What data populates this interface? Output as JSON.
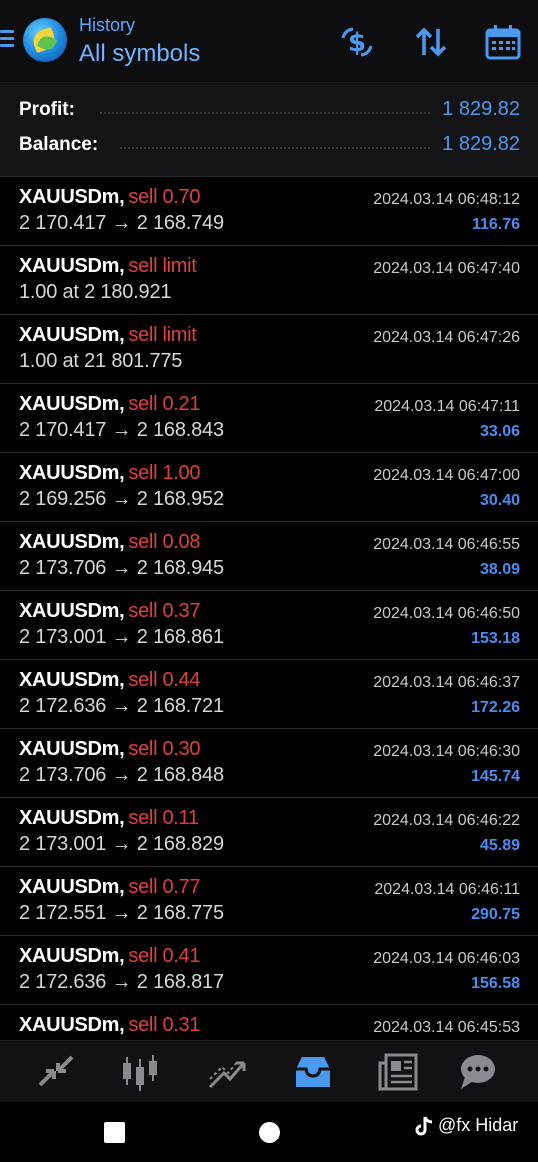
{
  "header": {
    "subtitle": "History",
    "title": "All symbols",
    "accent": "#4a9bf0"
  },
  "summary": {
    "profit_label": "Profit:",
    "profit_value": "1 829.82",
    "balance_label": "Balance:",
    "balance_value": "1 829.82"
  },
  "trades": [
    {
      "symbol": "XAUUSDm,",
      "side": "sell 0.70",
      "prices": "2 170.417 → 2 168.749",
      "time": "2024.03.14 06:48:12",
      "profit": "116.76"
    },
    {
      "symbol": "XAUUSDm,",
      "side": "sell limit",
      "prices": "1.00 at 2 180.921",
      "time": "2024.03.14 06:47:40",
      "profit": ""
    },
    {
      "symbol": "XAUUSDm,",
      "side": "sell limit",
      "prices": "1.00 at 21 801.775",
      "time": "2024.03.14 06:47:26",
      "profit": ""
    },
    {
      "symbol": "XAUUSDm,",
      "side": "sell 0.21",
      "prices": "2 170.417 → 2 168.843",
      "time": "2024.03.14 06:47:11",
      "profit": "33.06"
    },
    {
      "symbol": "XAUUSDm,",
      "side": "sell 1.00",
      "prices": "2 169.256 → 2 168.952",
      "time": "2024.03.14 06:47:00",
      "profit": "30.40"
    },
    {
      "symbol": "XAUUSDm,",
      "side": "sell 0.08",
      "prices": "2 173.706 → 2 168.945",
      "time": "2024.03.14 06:46:55",
      "profit": "38.09"
    },
    {
      "symbol": "XAUUSDm,",
      "side": "sell 0.37",
      "prices": "2 173.001 → 2 168.861",
      "time": "2024.03.14 06:46:50",
      "profit": "153.18"
    },
    {
      "symbol": "XAUUSDm,",
      "side": "sell 0.44",
      "prices": "2 172.636 → 2 168.721",
      "time": "2024.03.14 06:46:37",
      "profit": "172.26"
    },
    {
      "symbol": "XAUUSDm,",
      "side": "sell 0.30",
      "prices": "2 173.706 → 2 168.848",
      "time": "2024.03.14 06:46:30",
      "profit": "145.74"
    },
    {
      "symbol": "XAUUSDm,",
      "side": "sell 0.11",
      "prices": "2 173.001 → 2 168.829",
      "time": "2024.03.14 06:46:22",
      "profit": "45.89"
    },
    {
      "symbol": "XAUUSDm,",
      "side": "sell 0.77",
      "prices": "2 172.551 → 2 168.775",
      "time": "2024.03.14 06:46:11",
      "profit": "290.75"
    },
    {
      "symbol": "XAUUSDm,",
      "side": "sell 0.41",
      "prices": "2 172.636 → 2 168.817",
      "time": "2024.03.14 06:46:03",
      "profit": "156.58"
    },
    {
      "symbol": "XAUUSDm,",
      "side": "sell 0.31",
      "prices": "",
      "time": "2024.03.14 06:45:53",
      "profit": ""
    }
  ],
  "tabs": [
    {
      "icon": "quotes-icon",
      "active": false
    },
    {
      "icon": "chart-icon",
      "active": false
    },
    {
      "icon": "trade-icon",
      "active": false
    },
    {
      "icon": "history-icon",
      "active": true
    },
    {
      "icon": "news-icon",
      "active": false
    },
    {
      "icon": "messages-icon",
      "active": false
    }
  ],
  "watermark": "@fx Hidar"
}
